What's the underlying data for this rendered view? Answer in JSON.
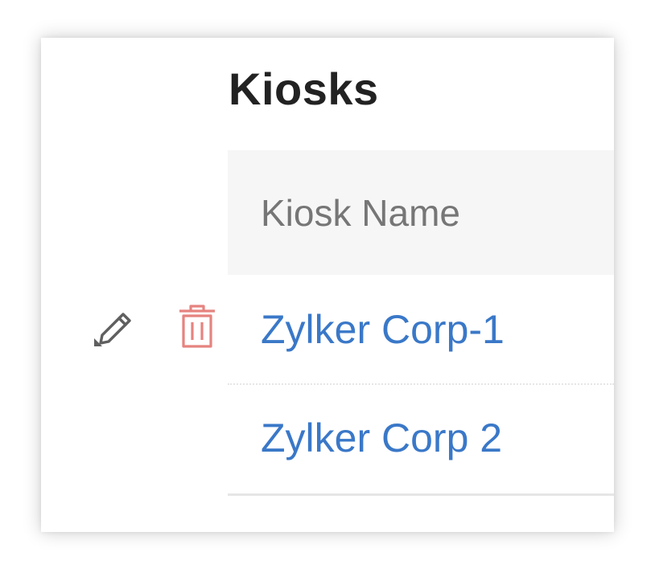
{
  "page": {
    "title": "Kiosks"
  },
  "table": {
    "columns": [
      "Kiosk Name"
    ],
    "rows": [
      {
        "name": "Zylker Corp-1"
      },
      {
        "name": "Zylker Corp 2"
      }
    ]
  },
  "icons": {
    "edit": "pencil-icon",
    "delete": "trash-icon"
  },
  "colors": {
    "title": "#222222",
    "header_bg": "#f6f6f6",
    "header_text": "#767676",
    "link": "#3a78c8",
    "edit_icon": "#5f5f5f",
    "delete_icon": "#e6837f",
    "row_border": "#e6e6e6"
  }
}
